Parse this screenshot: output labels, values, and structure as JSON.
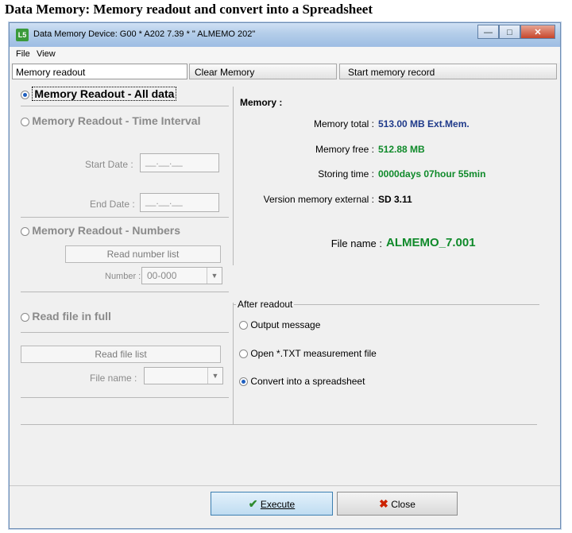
{
  "heading": "Data Memory: Memory readout and convert into a Spreadsheet",
  "window": {
    "title": "Data Memory  Device: G00 * A202 7.39 * \"  ALMEMO 202\"",
    "app_icon": "L5"
  },
  "menu": {
    "file": "File",
    "view": "View"
  },
  "toolbar": {
    "mode_value": "Memory readout",
    "clear_label": "Clear Memory",
    "start_label": "Start memory record"
  },
  "left": {
    "opt_all": "Memory Readout - All data",
    "opt_time": "Memory Readout - Time Interval",
    "start_date_label": "Start Date :",
    "start_date_value": "__.__.__",
    "end_date_label": "End Date :",
    "end_date_value": "__.__.__",
    "opt_numbers": "Memory Readout - Numbers",
    "read_number_list": "Read number list",
    "number_label": "Number :",
    "number_value": "00-000",
    "opt_file": "Read file in full",
    "read_file_list": "Read file list",
    "file_name_label": "File name :",
    "file_name_value": ""
  },
  "memory": {
    "title": "Memory :",
    "total_label": "Memory total :",
    "total_value": "513.00 MB  Ext.Mem.",
    "free_label": "Memory free :",
    "free_value": "512.88 MB",
    "storing_label": "Storing time :",
    "storing_value": "0000days 07hour 55min",
    "version_label": "Version memory external :",
    "version_value": "SD 3.11",
    "file_name_label": "File name :",
    "file_name_value": "ALMEMO_7.001"
  },
  "after_readout": {
    "title": "After readout",
    "opt_output": "Output message",
    "opt_open_txt": "Open *.TXT measurement file",
    "opt_convert": "Convert into a spreadsheet"
  },
  "buttons": {
    "execute": "Execute",
    "close": "Close"
  },
  "colors": {
    "blue_value": "#1f3a8a",
    "green_value": "#0f8a2a",
    "filename_green": "#0f8a2a"
  }
}
